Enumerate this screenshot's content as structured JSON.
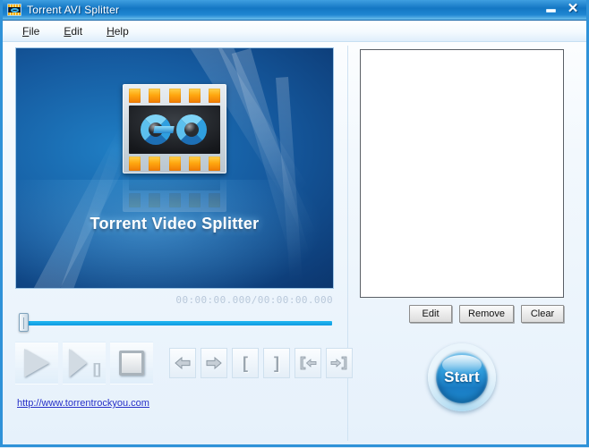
{
  "window": {
    "title": "Torrent AVI Splitter",
    "icon": "film-strip-icon",
    "minimize_label": "—",
    "close_label": "✕"
  },
  "menubar": {
    "items": [
      {
        "label": "File",
        "accel": "F"
      },
      {
        "label": "Edit",
        "accel": "E"
      },
      {
        "label": "Help",
        "accel": "H"
      }
    ]
  },
  "preview": {
    "splash_title": "Torrent Video Splitter",
    "logo": "film-strip-go-logo",
    "timecode": "00:00:00.000/00:00:00.000",
    "position_value": "0",
    "seek_min": "0",
    "seek_max": "100"
  },
  "transport": {
    "buttons": [
      {
        "name": "play-button",
        "icon": "play-icon",
        "label": "Play"
      },
      {
        "name": "step-frame-button",
        "icon": "step-frame-icon",
        "label": "Next frame"
      },
      {
        "name": "stop-button",
        "icon": "stop-icon",
        "label": "Stop"
      },
      {
        "name": "step-back-button",
        "icon": "arrow-left-icon",
        "label": "Back"
      },
      {
        "name": "step-forward-button",
        "icon": "arrow-right-icon",
        "label": "Forward"
      },
      {
        "name": "mark-in-button",
        "icon": "bracket-open-icon",
        "label": "["
      },
      {
        "name": "mark-out-button",
        "icon": "bracket-close-icon",
        "label": "]"
      },
      {
        "name": "goto-mark-in-button",
        "icon": "bracket-arrow-left-icon",
        "label": "[←"
      },
      {
        "name": "goto-mark-out-button",
        "icon": "bracket-arrow-right-icon",
        "label": "→]"
      }
    ],
    "mark_in_glyph": "[",
    "mark_out_glyph": "]"
  },
  "status": {
    "link_text": "http://www.torrentrockyou.com"
  },
  "segments": {
    "items": [],
    "buttons": {
      "edit": "Edit",
      "remove": "Remove",
      "clear": "Clear"
    }
  },
  "action": {
    "start_label": "Start"
  },
  "colors": {
    "titlebar_blue": "#1477c4",
    "window_border": "#2f92d8",
    "slider_blue": "#0e9ae0",
    "link_blue": "#2730c8",
    "start_blue": "#2f9ede",
    "film_orange": "#ffa810"
  }
}
